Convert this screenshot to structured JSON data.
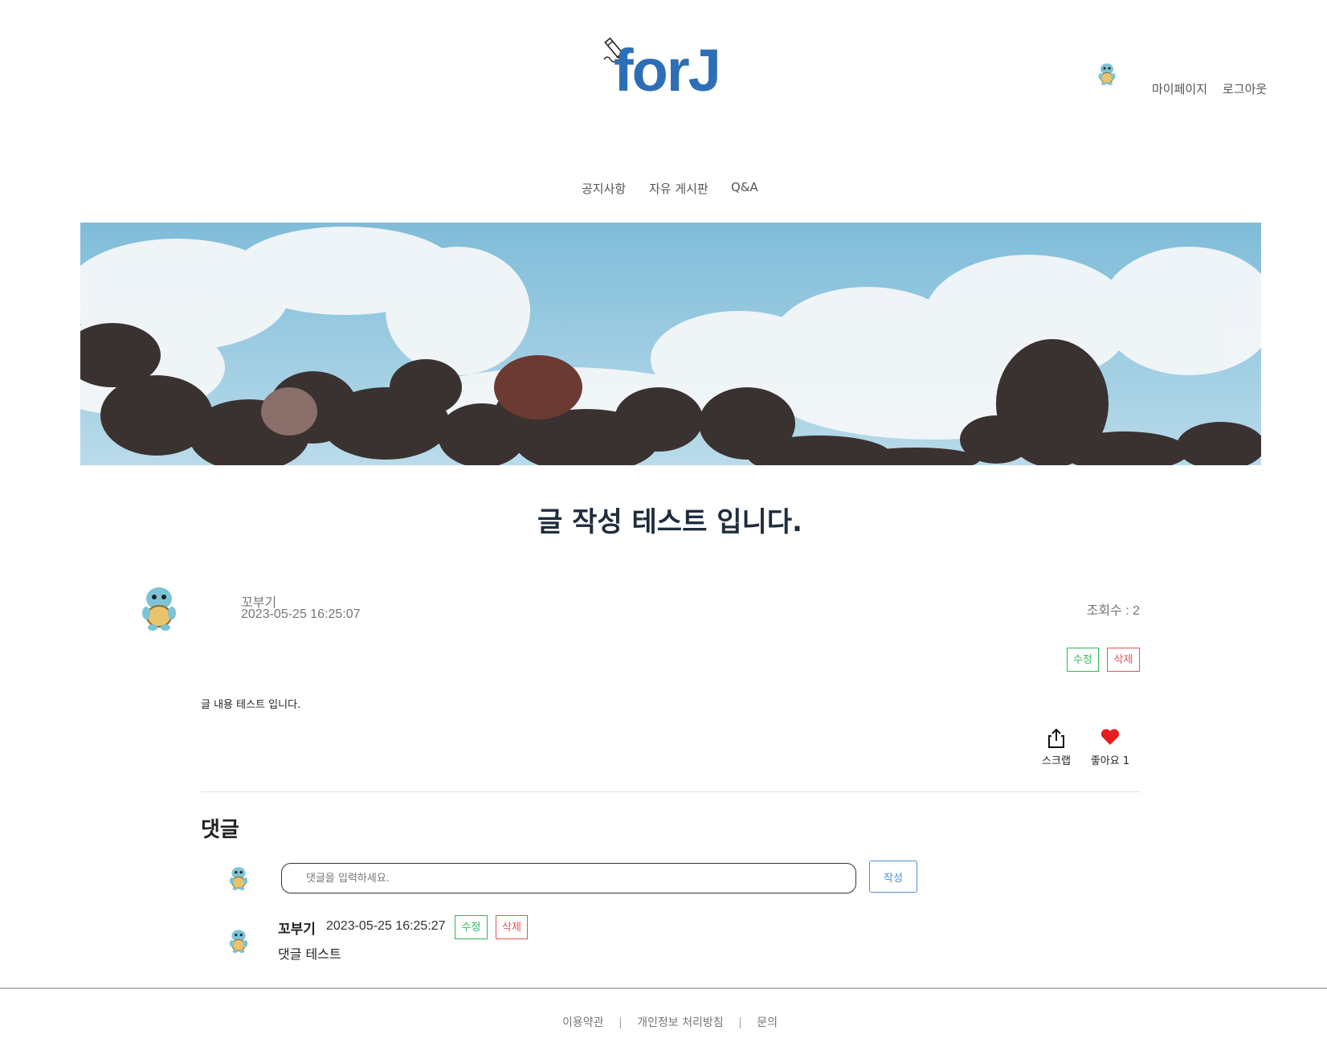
{
  "header": {
    "logo_text": "forJ",
    "mypage_label": "마이페이지",
    "logout_label": "로그아웃"
  },
  "nav": {
    "items": [
      {
        "label": "공지사항"
      },
      {
        "label": "자유 게시판"
      },
      {
        "label": "Q&A"
      }
    ]
  },
  "post": {
    "title": "글 작성 테스트 입니다.",
    "author": "꼬부기",
    "date": "2023-05-25 16:25:07",
    "views": "조회수 : 2",
    "edit_label": "수정",
    "delete_label": "삭제",
    "content": "글 내용 테스트 입니다.",
    "scrap_label": "스크랩",
    "like_label": "좋아요 1"
  },
  "comments": {
    "heading": "댓글",
    "input_placeholder": "댓글을 입력하세요.",
    "submit_label": "작성",
    "items": [
      {
        "author": "꼬부기",
        "date": "2023-05-25 16:25:27",
        "edit_label": "수정",
        "delete_label": "삭제",
        "text": "댓글 테스트"
      }
    ]
  },
  "footer": {
    "terms": "이용약관",
    "privacy": "개인정보 처리방침",
    "contact": "문의",
    "separator": "|"
  },
  "colors": {
    "logo": "#2c6fb7",
    "edit": "#2eb85c",
    "delete": "#e55353",
    "submit": "#4a90d9",
    "heart": "#e81d1d"
  },
  "icons": {
    "avatar": "turtle-avatar-icon",
    "scrap": "share-icon",
    "like": "heart-icon",
    "logo_pencil": "pencil-icon"
  }
}
